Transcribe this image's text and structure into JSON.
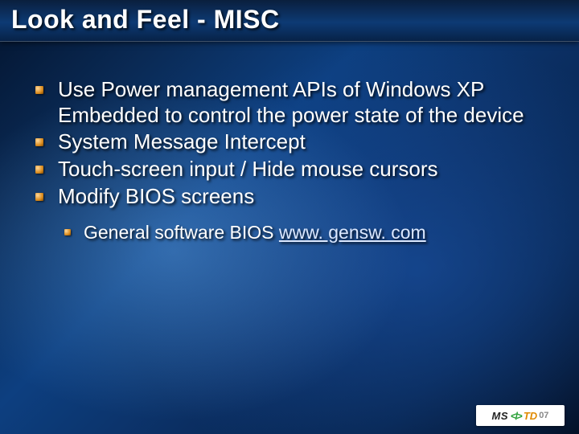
{
  "title": "Look and Feel - MISC",
  "bullets": {
    "b1": "Use Power management APIs of Windows XP Embedded to control the power state of the device",
    "b2": "System Message Intercept",
    "b3": "Touch-screen input / Hide mouse cursors",
    "b4": "Modify BIOS screens"
  },
  "sub": {
    "s1_prefix": "General software BIOS ",
    "s1_link": "www. gensw. com"
  },
  "logo": {
    "ms": "MS",
    "chev": "</>",
    "td": "TD",
    "yr": "07"
  }
}
